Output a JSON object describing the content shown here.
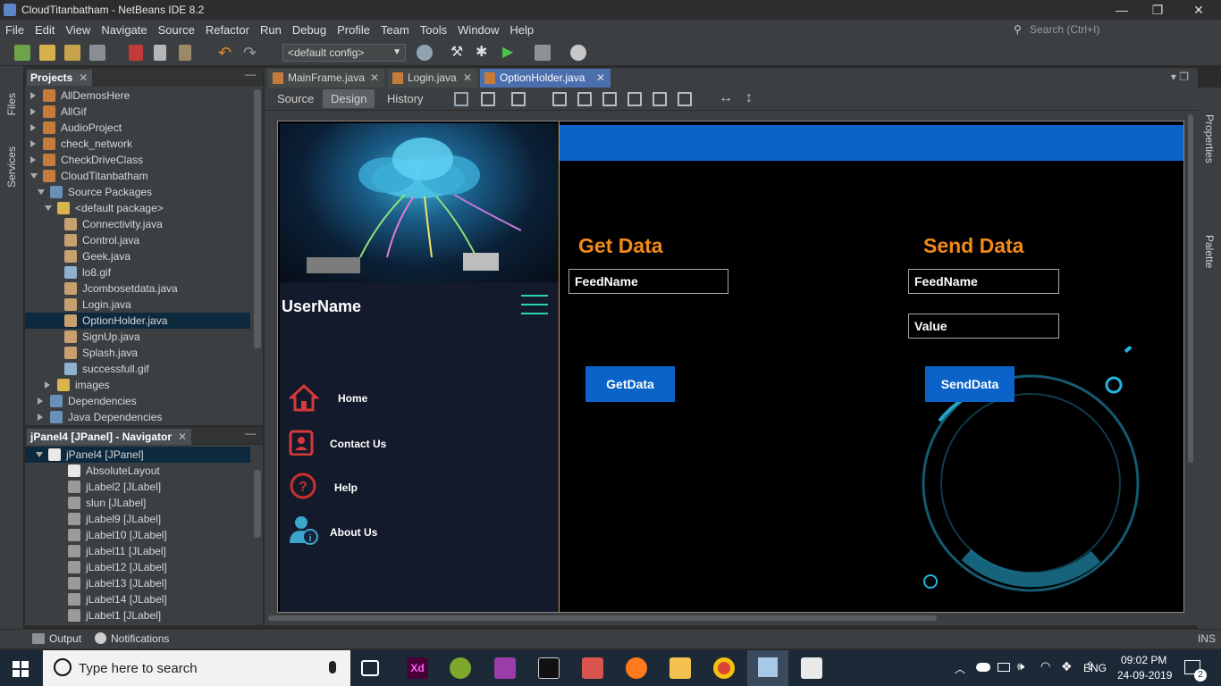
{
  "titlebar": {
    "title": "CloudTitanbatham - NetBeans IDE 8.2",
    "min": "—",
    "max": "❐",
    "close": "✕"
  },
  "menubar": {
    "items": [
      "File",
      "Edit",
      "View",
      "Navigate",
      "Source",
      "Refactor",
      "Run",
      "Debug",
      "Profile",
      "Team",
      "Tools",
      "Window",
      "Help"
    ],
    "search_placeholder": "Search (Ctrl+I)"
  },
  "toolbar": {
    "config": "<default config>"
  },
  "leftstrip": {
    "files": "Files",
    "services": "Services"
  },
  "projects": {
    "title": "Projects",
    "rows": [
      {
        "label": "AllDemosHere"
      },
      {
        "label": "AllGif"
      },
      {
        "label": "AudioProject"
      },
      {
        "label": "check_network"
      },
      {
        "label": "CheckDriveClass"
      },
      {
        "label": "CloudTitanbatham"
      },
      {
        "label": "Source Packages"
      },
      {
        "label": "<default package>"
      },
      {
        "label": "Connectivity.java"
      },
      {
        "label": "Control.java"
      },
      {
        "label": "Geek.java"
      },
      {
        "label": "lo8.gif"
      },
      {
        "label": "Jcombosetdata.java"
      },
      {
        "label": "Login.java"
      },
      {
        "label": "OptionHolder.java"
      },
      {
        "label": "SignUp.java"
      },
      {
        "label": "Splash.java"
      },
      {
        "label": "successfull.gif"
      },
      {
        "label": "images"
      },
      {
        "label": "Dependencies"
      },
      {
        "label": "Java Dependencies"
      }
    ]
  },
  "navigator": {
    "title": "jPanel4 [JPanel] - Navigator",
    "rows": [
      {
        "label": "jPanel4 [JPanel]"
      },
      {
        "label": "AbsoluteLayout"
      },
      {
        "label": "jLabel2 [JLabel]"
      },
      {
        "label": "slun [JLabel]"
      },
      {
        "label": "jLabel9 [JLabel]"
      },
      {
        "label": "jLabel10 [JLabel]"
      },
      {
        "label": "jLabel11 [JLabel]"
      },
      {
        "label": "jLabel12 [JLabel]"
      },
      {
        "label": "jLabel13 [JLabel]"
      },
      {
        "label": "jLabel14 [JLabel]"
      },
      {
        "label": "jLabel1 [JLabel]"
      }
    ]
  },
  "editor": {
    "tabs": [
      "MainFrame.java",
      "Login.java",
      "OptionHolder.java"
    ],
    "design_tabs": [
      "Source",
      "Design",
      "History"
    ]
  },
  "form": {
    "username": "UserName",
    "menu": [
      "Home",
      "Contact Us",
      "Help",
      "About Us"
    ],
    "get_title": "Get Data",
    "send_title": "Send Data",
    "get_field": "FeedName",
    "send_field": "FeedName",
    "value_field": "Value",
    "get_button": "GetData",
    "send_button": "SendData"
  },
  "rightstrip": {
    "properties": "Properties",
    "palette": "Palette"
  },
  "bottombar": {
    "output": "Output",
    "notifications": "Notifications",
    "ins": "INS"
  },
  "taskbar": {
    "search": "Type here to search",
    "lang": "ENG",
    "time": "09:02 PM",
    "date": "24-09-2019",
    "notif_count": "2"
  },
  "colors": {
    "accent": "#0b63c9",
    "orange": "#f28a1a",
    "selection": "#4b6eaf"
  }
}
